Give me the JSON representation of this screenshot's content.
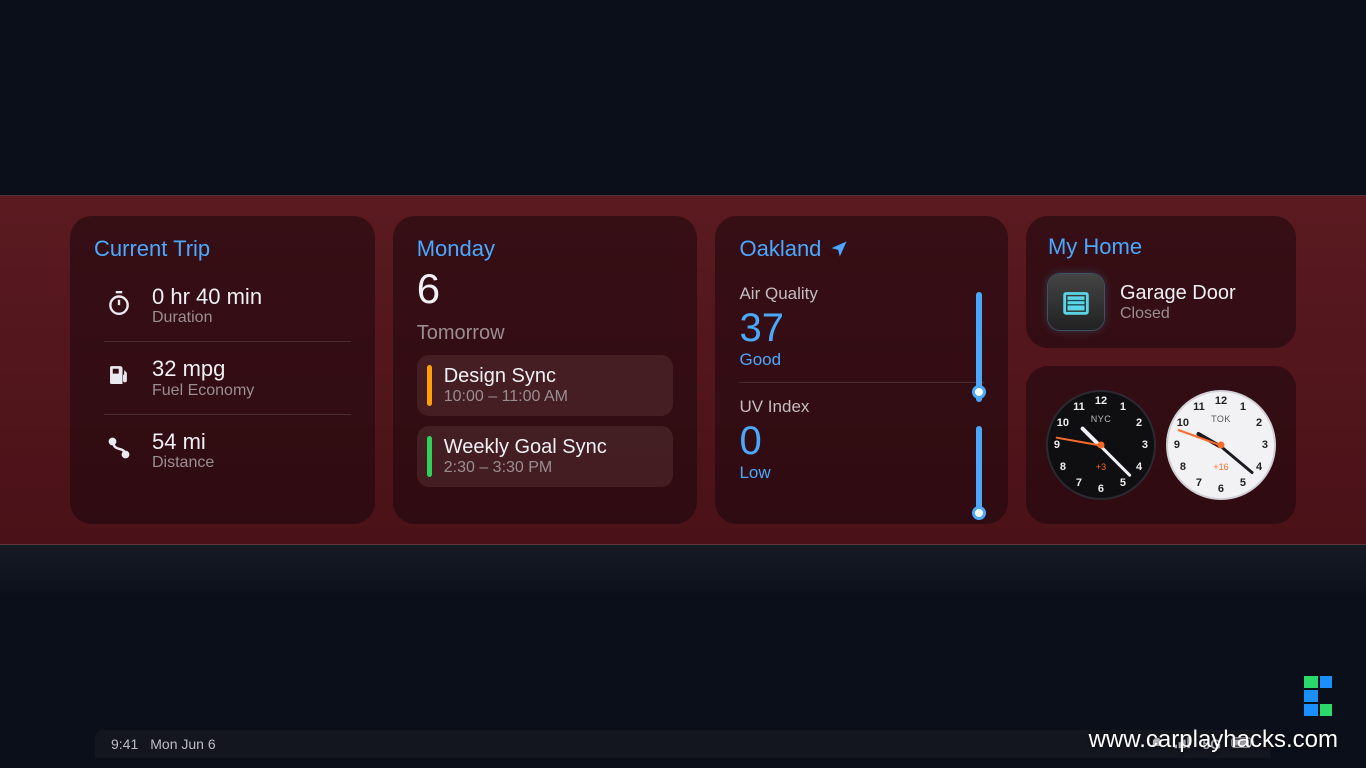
{
  "trip": {
    "title": "Current Trip",
    "rows": [
      {
        "value": "0 hr 40 min",
        "label": "Duration"
      },
      {
        "value": "32 mpg",
        "label": "Fuel Economy"
      },
      {
        "value": "54 mi",
        "label": "Distance"
      }
    ]
  },
  "calendar": {
    "day_name": "Monday",
    "day_num": "6",
    "tomorrow_label": "Tomorrow",
    "events": [
      {
        "title": "Design Sync",
        "time": "10:00 – 11:00 AM",
        "color": "orange"
      },
      {
        "title": "Weekly Goal Sync",
        "time": "2:30 – 3:30 PM",
        "color": "green"
      }
    ]
  },
  "weather": {
    "location": "Oakland",
    "metrics": [
      {
        "label": "Air Quality",
        "value": "37",
        "desc": "Good"
      },
      {
        "label": "UV Index",
        "value": "0",
        "desc": "Low"
      }
    ]
  },
  "home": {
    "title": "My Home",
    "device": "Garage Door",
    "status": "Closed"
  },
  "clocks": [
    {
      "city": "NYC",
      "offset": "+3"
    },
    {
      "city": "TOK",
      "offset": "+16"
    }
  ],
  "status_bar": {
    "time": "9:41",
    "date": "Mon Jun 6",
    "network": "5G"
  },
  "watermark": "www.carplayhacks.com"
}
